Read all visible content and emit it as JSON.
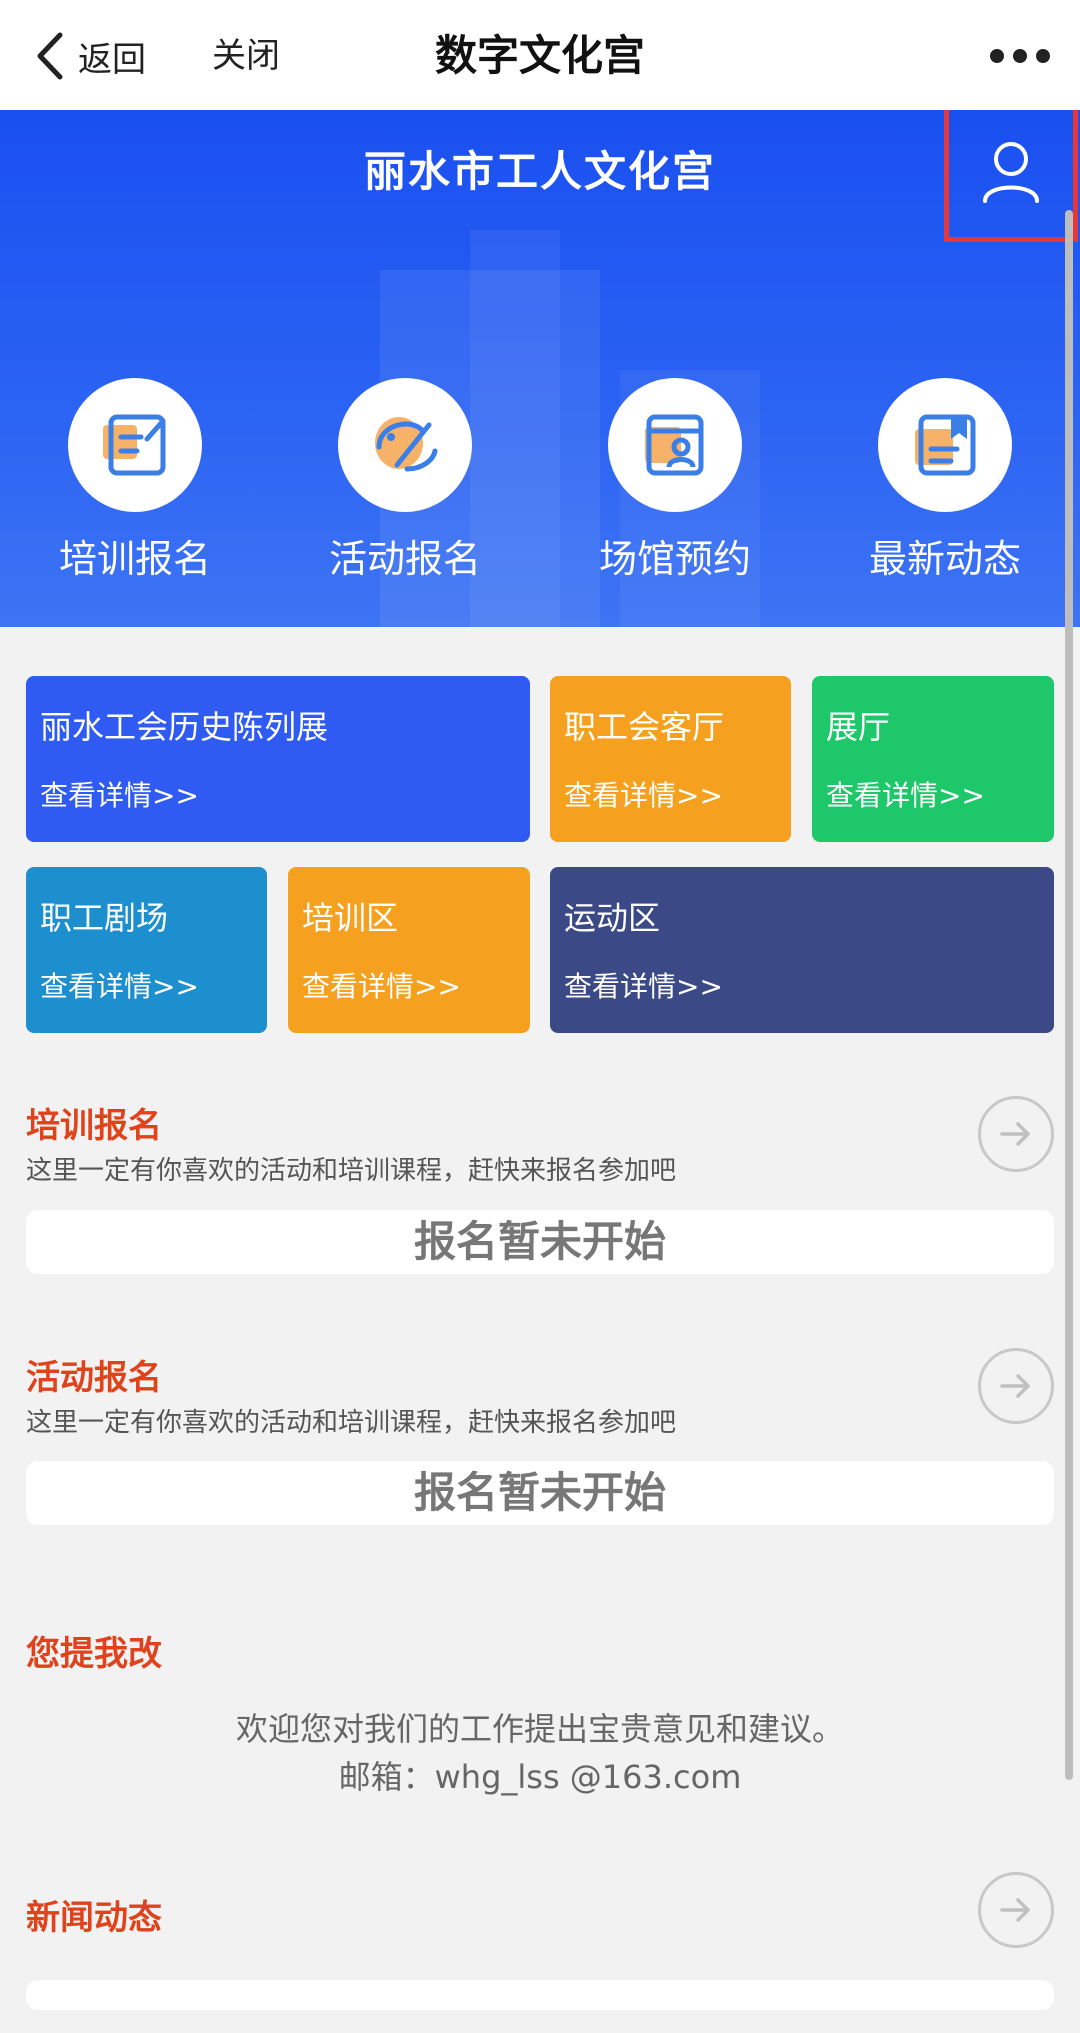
{
  "nav": {
    "back_label": "返回",
    "close_label": "关闭",
    "title": "数字文化宫"
  },
  "hero": {
    "title": "丽水市工人文化宫",
    "quick_links": [
      {
        "label": "培训报名",
        "icon": "training-signup-icon"
      },
      {
        "label": "活动报名",
        "icon": "activity-signup-icon"
      },
      {
        "label": "场馆预约",
        "icon": "venue-booking-icon"
      },
      {
        "label": "最新动态",
        "icon": "latest-news-icon"
      }
    ]
  },
  "tiles": [
    {
      "title": "丽水工会历史陈列展",
      "link": "查看详情>>",
      "color": "#2f5bf2"
    },
    {
      "title": "职工会客厅",
      "link": "查看详情>>",
      "color": "#f5a11f"
    },
    {
      "title": "展厅",
      "link": "查看详情>>",
      "color": "#1ec86a"
    },
    {
      "title": "职工剧场",
      "link": "查看详情>>",
      "color": "#1d8fcf"
    },
    {
      "title": "培训区",
      "link": "查看详情>>",
      "color": "#f5a11f"
    },
    {
      "title": "运动区",
      "link": "查看详情>>",
      "color": "#3b4a86"
    }
  ],
  "training": {
    "title": "培训报名",
    "subtitle": "这里一定有你喜欢的活动和培训课程，赶快来报名参加吧",
    "status": "报名暂未开始"
  },
  "activity": {
    "title": "活动报名",
    "subtitle": "这里一定有你喜欢的活动和培训课程，赶快来报名参加吧",
    "status": "报名暂未开始"
  },
  "feedback": {
    "title": "您提我改",
    "line1": "欢迎您对我们的工作提出宝贵意见和建议。",
    "line2": "邮箱：whg_lss @163.com"
  },
  "news": {
    "title": "新闻动态"
  },
  "colors": {
    "accent_red": "#e0421b",
    "hero_blue": "#1a4ff0",
    "highlight_red": "#e5383b"
  }
}
